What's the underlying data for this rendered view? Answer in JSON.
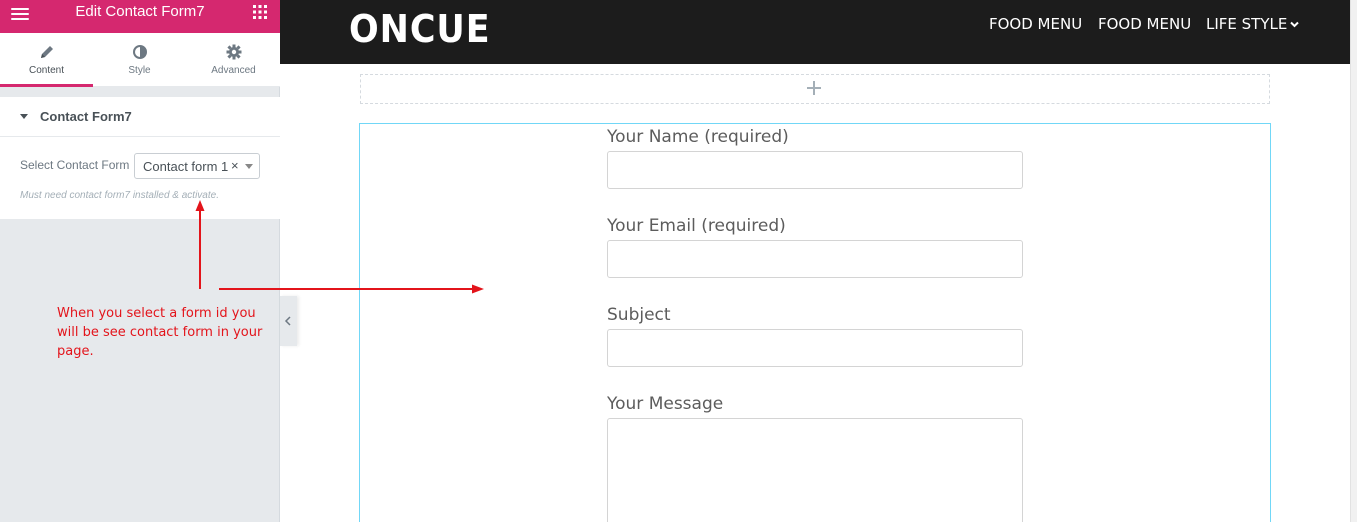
{
  "panel": {
    "title": "Edit Contact Form7",
    "tabs": [
      {
        "label": "Content",
        "icon": "pencil-icon",
        "active": true
      },
      {
        "label": "Style",
        "icon": "contrast-icon",
        "active": false
      },
      {
        "label": "Advanced",
        "icon": "gear-icon",
        "active": false
      }
    ],
    "section_title": "Contact Form7",
    "select_label": "Select Contact Form",
    "select_value": "Contact form 1",
    "select_clear": "×",
    "help_text": "Must need contact form7 installed & activate."
  },
  "annotation": {
    "text": "When you select a form id you will be see contact form in your page.",
    "color": "#e3141b"
  },
  "site": {
    "logo": "ONCUE",
    "nav": [
      "FOOD MENU",
      "FOOD MENU",
      "LIFE STYLE"
    ]
  },
  "form": {
    "fields": [
      {
        "label": "Your Name (required)",
        "value": ""
      },
      {
        "label": "Your Email (required)",
        "value": ""
      },
      {
        "label": "Subject",
        "value": ""
      },
      {
        "label": "Your Message",
        "value": ""
      }
    ]
  },
  "colors": {
    "accent": "#d5286f",
    "header_bg": "#1c1c1c",
    "widget_outline": "#71d7f7"
  }
}
